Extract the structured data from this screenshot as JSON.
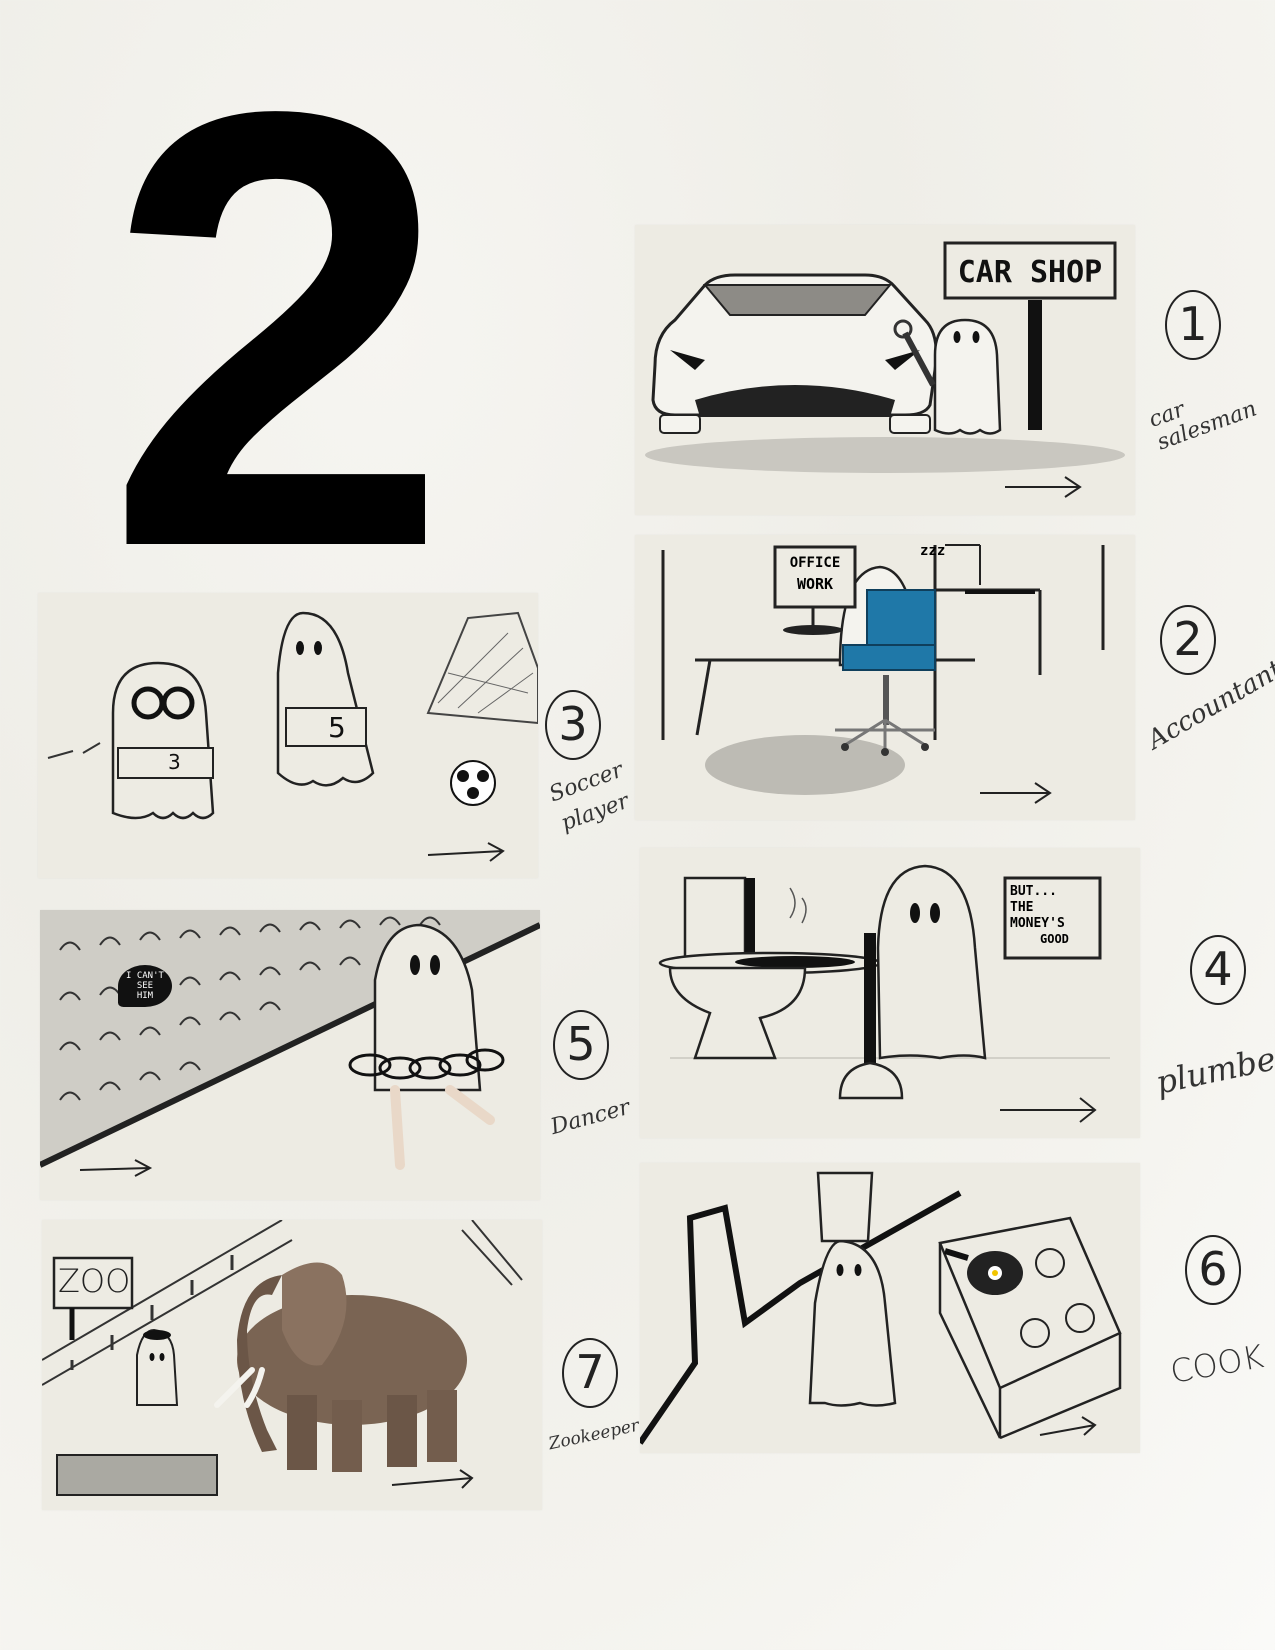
{
  "page": {
    "title_digit": "2"
  },
  "signs": {
    "car_shop": "CAR SHOP",
    "office_work_line1": "OFFICE",
    "office_work_line2": "WORK",
    "zzz": "zzz",
    "money_line1": "BUT...",
    "money_line2": "THE",
    "money_line3": "MONEY'S",
    "money_line4": "GOOD",
    "bubble_line1": "I CAN'T",
    "bubble_line2": "SEE",
    "bubble_line3": "HIM",
    "zoo": "ZOO"
  },
  "panels": [
    {
      "number": "1",
      "label": "car salesman"
    },
    {
      "number": "2",
      "label": "Accountant"
    },
    {
      "number": "3",
      "label_line1": "Soccer",
      "label_line2": "player",
      "jersey_a": "3",
      "jersey_b": "5"
    },
    {
      "number": "4",
      "label": "plumber"
    },
    {
      "number": "5",
      "label": "Dancer"
    },
    {
      "number": "6",
      "label": "COOK"
    },
    {
      "number": "7",
      "label": "Zookeeper"
    }
  ],
  "colors": {
    "panel_bg": "#edebe3",
    "ink": "#111111",
    "chair_blue": "#1f78a8",
    "elephant": "#7a6453"
  }
}
